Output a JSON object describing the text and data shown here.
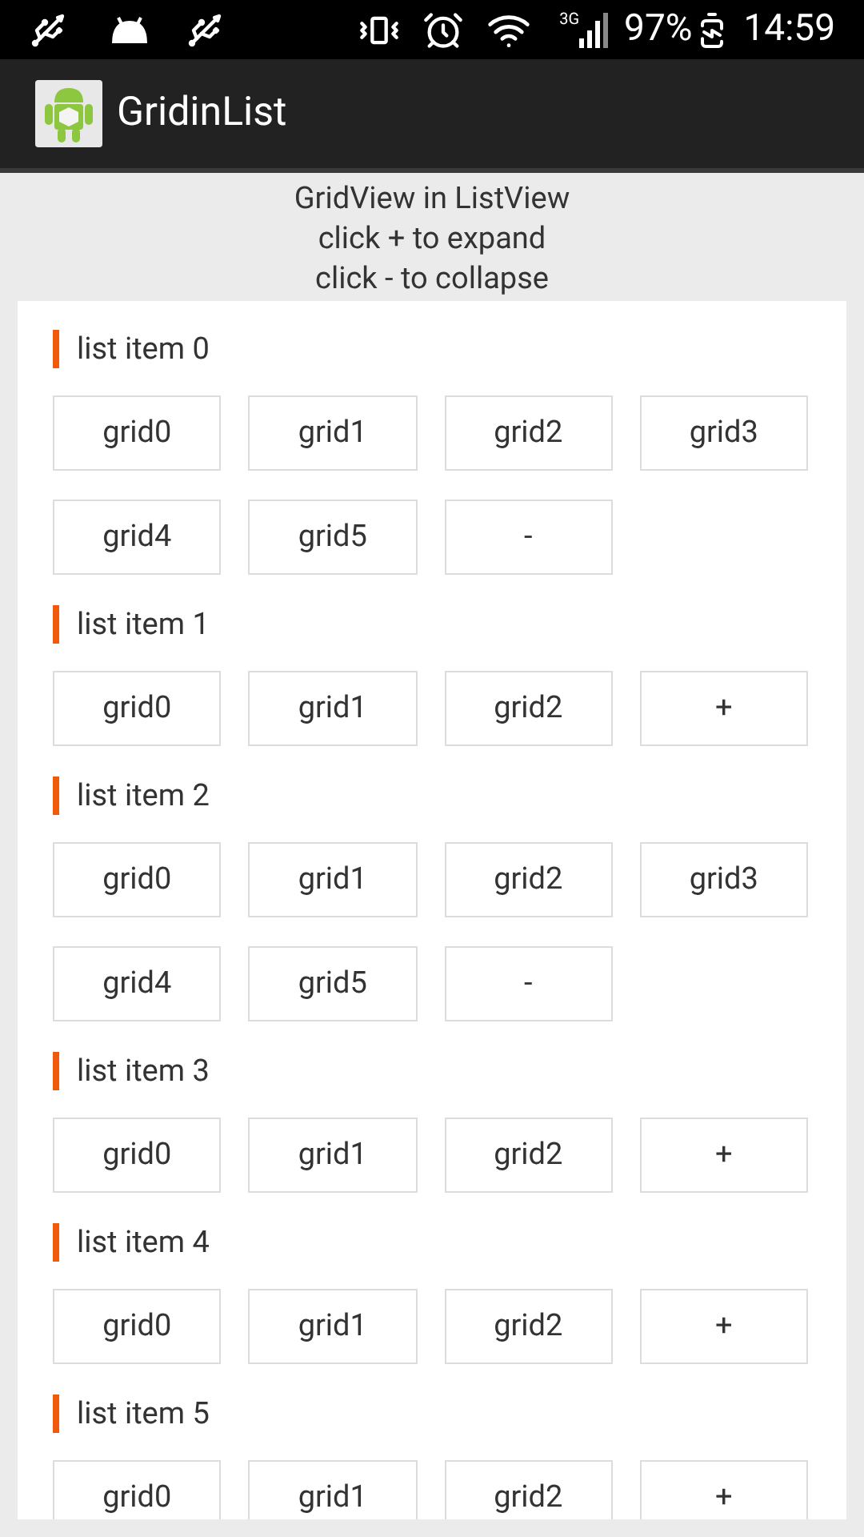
{
  "status_bar": {
    "network": "3G",
    "battery": "97%",
    "time": "14:59"
  },
  "app_bar": {
    "title": "GridinList"
  },
  "header_lines": [
    "GridView in ListView",
    "click + to expand",
    "click - to collapse"
  ],
  "list_items": [
    {
      "title": "list item 0",
      "cells": [
        "grid0",
        "grid1",
        "grid2",
        "grid3",
        "grid4",
        "grid5",
        "-"
      ]
    },
    {
      "title": "list item 1",
      "cells": [
        "grid0",
        "grid1",
        "grid2",
        "+"
      ]
    },
    {
      "title": "list item 2",
      "cells": [
        "grid0",
        "grid1",
        "grid2",
        "grid3",
        "grid4",
        "grid5",
        "-"
      ]
    },
    {
      "title": "list item 3",
      "cells": [
        "grid0",
        "grid1",
        "grid2",
        "+"
      ]
    },
    {
      "title": "list item 4",
      "cells": [
        "grid0",
        "grid1",
        "grid2",
        "+"
      ]
    },
    {
      "title": "list item 5",
      "cells": [
        "grid0",
        "grid1",
        "grid2",
        "+"
      ]
    }
  ]
}
